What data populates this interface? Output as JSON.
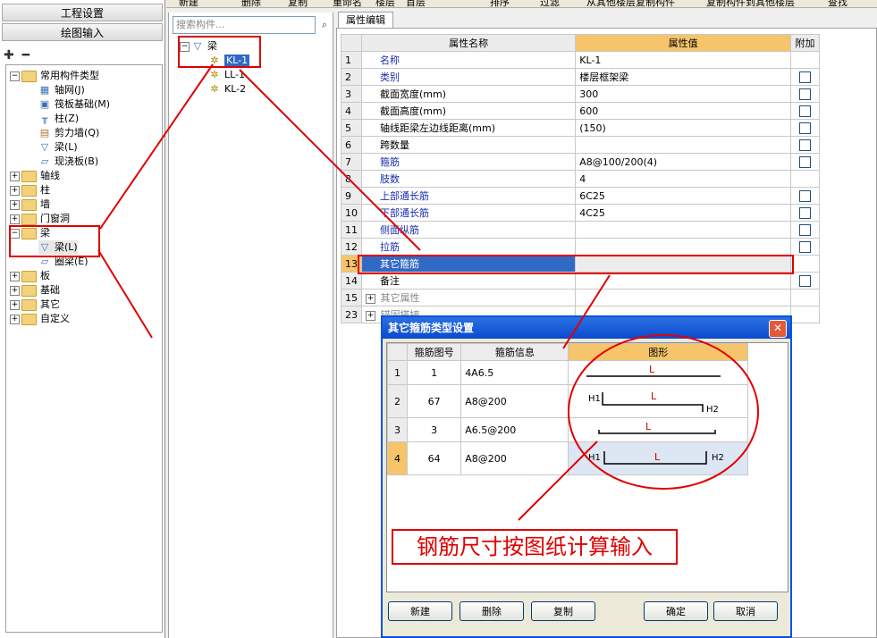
{
  "toolbar": {
    "items": [
      "新建",
      "删除",
      "复制",
      "重命名",
      "楼层",
      "首层",
      "排序",
      "过滤",
      "从其他楼层复制构件",
      "复制构件到其他楼层",
      "查找"
    ]
  },
  "left_panel": {
    "project_settings": "工程设置",
    "drawing_input": "绘图输入",
    "tree": [
      {
        "label": "常用构件类型",
        "type": "folder",
        "expanded": true
      },
      {
        "label": "轴网(J)",
        "type": "item",
        "icon": "grid-icon"
      },
      {
        "label": "筏板基础(M)",
        "type": "item",
        "icon": "raft-icon"
      },
      {
        "label": "柱(Z)",
        "type": "item",
        "icon": "column-icon"
      },
      {
        "label": "剪力墙(Q)",
        "type": "item",
        "icon": "wall-icon"
      },
      {
        "label": "梁(L)",
        "type": "item",
        "icon": "beam-icon"
      },
      {
        "label": "现浇板(B)",
        "type": "item",
        "icon": "slab-icon"
      },
      {
        "label": "轴线",
        "type": "folder"
      },
      {
        "label": "柱",
        "type": "folder"
      },
      {
        "label": "墙",
        "type": "folder"
      },
      {
        "label": "门窗洞",
        "type": "folder"
      },
      {
        "label": "梁",
        "type": "folder",
        "expanded": true
      },
      {
        "label": "梁(L)",
        "type": "item",
        "icon": "beam-icon",
        "selected": true
      },
      {
        "label": "圈梁(E)",
        "type": "item",
        "icon": "ring-beam-icon"
      },
      {
        "label": "板",
        "type": "folder"
      },
      {
        "label": "基础",
        "type": "folder"
      },
      {
        "label": "其它",
        "type": "folder"
      },
      {
        "label": "自定义",
        "type": "folder"
      }
    ]
  },
  "middle_panel": {
    "search_placeholder": "搜索构件...",
    "root": "梁",
    "items": [
      "KL-1",
      "LL-1",
      "KL-2"
    ],
    "selected": "KL-1"
  },
  "properties": {
    "tab": "属性编辑",
    "headers": [
      "属性名称",
      "属性值",
      "附加"
    ],
    "rows": [
      {
        "n": "1",
        "name": "名称",
        "value": "KL-1",
        "blue": true,
        "check": false
      },
      {
        "n": "2",
        "name": "类别",
        "value": "楼层框架梁",
        "blue": true,
        "check": true
      },
      {
        "n": "3",
        "name": "截面宽度(mm)",
        "value": "300",
        "blue": false,
        "check": true
      },
      {
        "n": "4",
        "name": "截面高度(mm)",
        "value": "600",
        "blue": false,
        "check": true
      },
      {
        "n": "5",
        "name": "轴线距梁左边线距离(mm)",
        "value": "(150)",
        "blue": false,
        "check": true
      },
      {
        "n": "6",
        "name": "跨数量",
        "value": "",
        "blue": false,
        "check": true
      },
      {
        "n": "7",
        "name": "箍筋",
        "value": "A8@100/200(4)",
        "blue": true,
        "check": true
      },
      {
        "n": "8",
        "name": "肢数",
        "value": "4",
        "blue": true,
        "check": false
      },
      {
        "n": "9",
        "name": "上部通长筋",
        "value": "6C25",
        "blue": true,
        "check": true
      },
      {
        "n": "10",
        "name": "下部通长筋",
        "value": "4C25",
        "blue": true,
        "check": true
      },
      {
        "n": "11",
        "name": "侧面纵筋",
        "value": "",
        "blue": true,
        "check": true
      },
      {
        "n": "12",
        "name": "拉筋",
        "value": "",
        "blue": true,
        "check": true
      },
      {
        "n": "13",
        "name": "其它箍筋",
        "value": "",
        "blue": false,
        "check": false,
        "selected": true
      },
      {
        "n": "14",
        "name": "备注",
        "value": "",
        "blue": false,
        "check": true
      },
      {
        "n": "15",
        "name": "其它属性",
        "value": "",
        "blue": false,
        "check": false,
        "group": true
      },
      {
        "n": "23",
        "name": "锚固搭接",
        "value": "",
        "blue": false,
        "check": false,
        "group": true
      }
    ]
  },
  "dialog": {
    "title": "其它箍筋类型设置",
    "headers": [
      "箍筋图号",
      "箍筋信息",
      "图形"
    ],
    "rows": [
      {
        "n": "1",
        "code": "1",
        "info": "4A6.5",
        "shape": "straight",
        "label_l": "L"
      },
      {
        "n": "2",
        "code": "67",
        "info": "A8@200",
        "shape": "hook",
        "label_l": "L",
        "label_h1": "H1",
        "label_h2": "H2"
      },
      {
        "n": "3",
        "code": "3",
        "info": "A6.5@200",
        "shape": "straight-bent",
        "label_l": "L"
      },
      {
        "n": "4",
        "code": "64",
        "info": "A8@200",
        "shape": "u",
        "label_l": "L",
        "label_h1": "H1",
        "label_h2": "H2",
        "selected": true
      }
    ],
    "buttons": {
      "new": "新建",
      "delete": "删除",
      "copy": "复制",
      "ok": "确定",
      "cancel": "取消"
    }
  },
  "annotation": {
    "note": "钢筋尺寸按图纸计算输入",
    "color": "#e00000"
  }
}
